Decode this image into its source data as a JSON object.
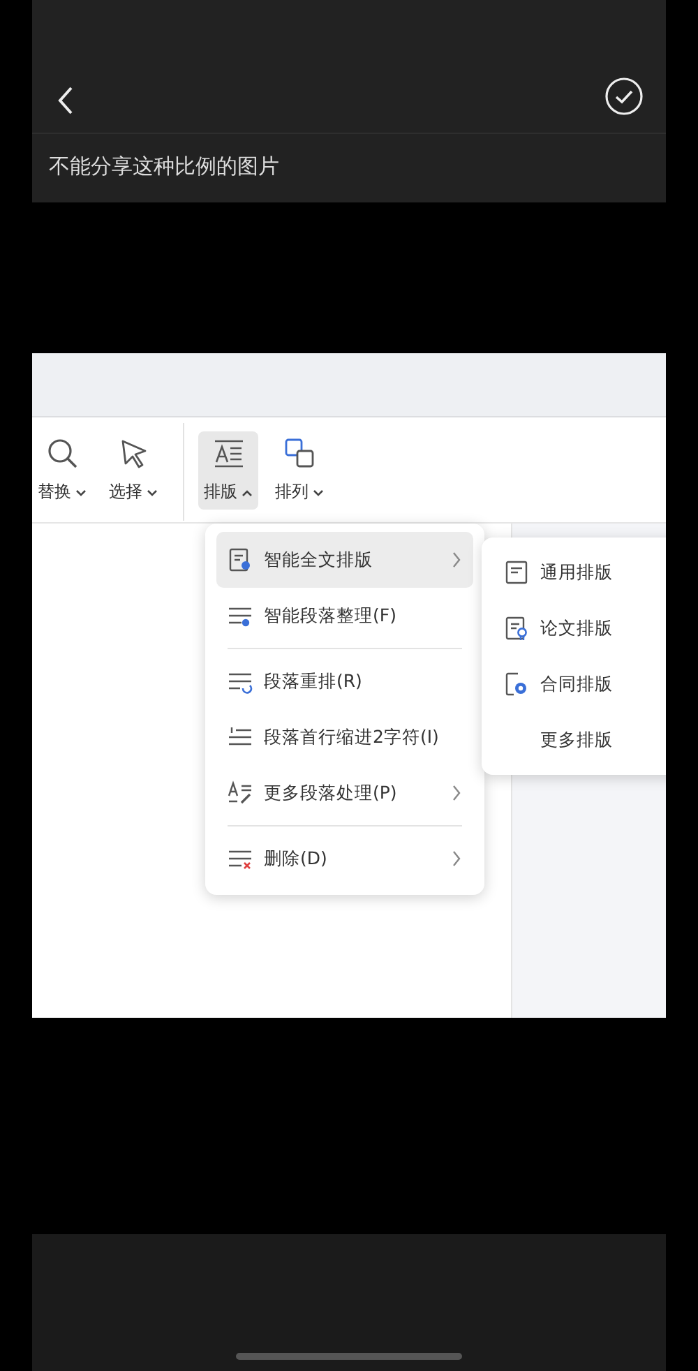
{
  "header": {
    "title": "不能分享这种比例的图片"
  },
  "ribbon": {
    "tools": [
      {
        "label": "替换",
        "kind": "search",
        "selected": false,
        "expanded": false
      },
      {
        "label": "选择",
        "kind": "pointer",
        "selected": false,
        "expanded": false
      },
      {
        "label": "排版",
        "kind": "layout",
        "selected": true,
        "expanded": true
      },
      {
        "label": "排列",
        "kind": "arrange",
        "selected": false,
        "expanded": false
      }
    ]
  },
  "menu": {
    "groups": [
      [
        {
          "label": "智能全文排版",
          "kind": "smart-doc",
          "selected": true,
          "has_submenu": true
        },
        {
          "label": "智能段落整理(F)",
          "kind": "smart-para",
          "selected": false,
          "has_submenu": false
        }
      ],
      [
        {
          "label": "段落重排(R)",
          "kind": "reflow",
          "selected": false,
          "has_submenu": false
        },
        {
          "label": "段落首行缩进2字符(I)",
          "kind": "indent",
          "selected": false,
          "has_submenu": false
        },
        {
          "label": "更多段落处理(P)",
          "kind": "more",
          "selected": false,
          "has_submenu": true
        }
      ],
      [
        {
          "label": "删除(D)",
          "kind": "delete",
          "selected": false,
          "has_submenu": true
        }
      ]
    ]
  },
  "submenu": {
    "items": [
      {
        "label": "通用排版",
        "kind": "general"
      },
      {
        "label": "论文排版",
        "kind": "thesis"
      },
      {
        "label": "合同排版",
        "kind": "contract"
      },
      {
        "label": "更多排版",
        "kind": "plain"
      }
    ]
  }
}
